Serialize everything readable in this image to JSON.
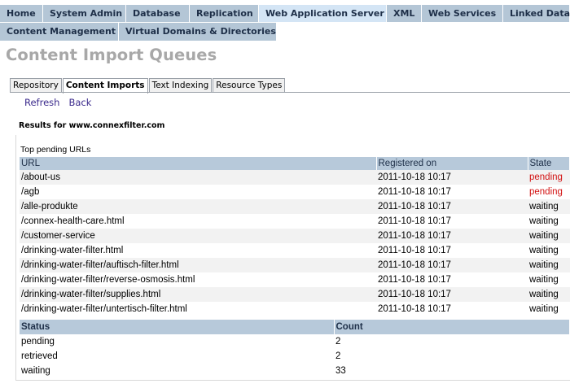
{
  "nav": {
    "primary_tabs": [
      "Home",
      "System Admin",
      "Database",
      "Replication",
      "Web Application Server",
      "XML",
      "Web Services",
      "Linked Data"
    ],
    "secondary_tabs": [
      "Content Management",
      "Virtual Domains & Directories"
    ]
  },
  "page": {
    "title": "Content Import Queues"
  },
  "subtabs": [
    "Repository",
    "Content Imports",
    "Text Indexing",
    "Resource Types"
  ],
  "actions": {
    "refresh": "Refresh",
    "back": "Back"
  },
  "results_for": "Results for www.connexfilter.com",
  "pending_urls": {
    "caption": "Top pending URLs",
    "headers": [
      "URL",
      "Registered on",
      "State"
    ],
    "rows": [
      [
        "/about-us",
        "2011-10-18 10:17",
        "pending"
      ],
      [
        "/agb",
        "2011-10-18 10:17",
        "pending"
      ],
      [
        "/alle-produkte",
        "2011-10-18 10:17",
        "waiting"
      ],
      [
        "/connex-health-care.html",
        "2011-10-18 10:17",
        "waiting"
      ],
      [
        "/customer-service",
        "2011-10-18 10:17",
        "waiting"
      ],
      [
        "/drinking-water-filter.html",
        "2011-10-18 10:17",
        "waiting"
      ],
      [
        "/drinking-water-filter/auftisch-filter.html",
        "2011-10-18 10:17",
        "waiting"
      ],
      [
        "/drinking-water-filter/reverse-osmosis.html",
        "2011-10-18 10:17",
        "waiting"
      ],
      [
        "/drinking-water-filter/supplies.html",
        "2011-10-18 10:17",
        "waiting"
      ],
      [
        "/drinking-water-filter/untertisch-filter.html",
        "2011-10-18 10:17",
        "waiting"
      ]
    ]
  },
  "status_counts": {
    "headers": [
      "Status",
      "Count"
    ],
    "rows": [
      [
        "pending",
        "2"
      ],
      [
        "retrieved",
        "2"
      ],
      [
        "waiting",
        "33"
      ]
    ]
  },
  "colors": {
    "tab_bg": "#b4c6d6",
    "tab_active_bg": "#d4e5f5",
    "title_gray": "#a8a8a8",
    "pending_red": "#d21010",
    "link_purple": "#3b2a8c"
  }
}
